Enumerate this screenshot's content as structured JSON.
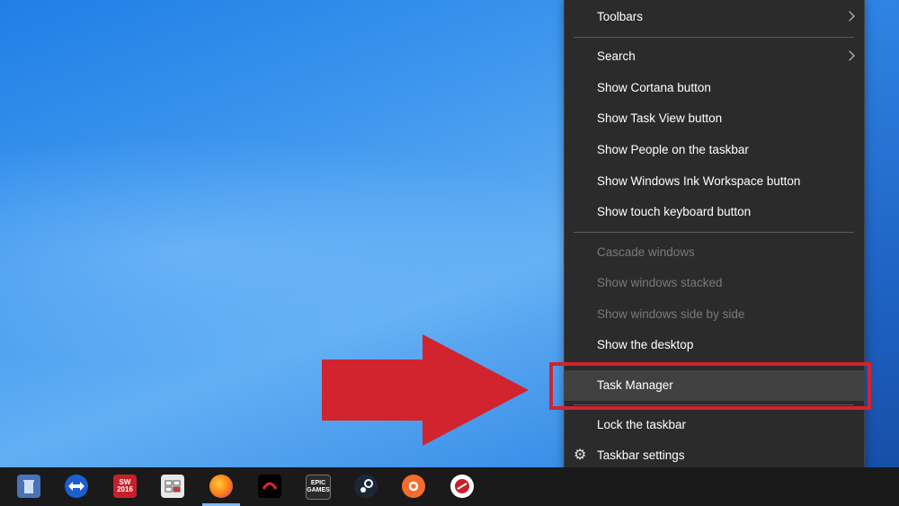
{
  "menu": {
    "items": [
      {
        "label": "Toolbars",
        "has_submenu": true
      },
      {
        "label": "Search",
        "has_submenu": true
      },
      {
        "label": "Show Cortana button"
      },
      {
        "label": "Show Task View button"
      },
      {
        "label": "Show People on the taskbar"
      },
      {
        "label": "Show Windows Ink Workspace button"
      },
      {
        "label": "Show touch keyboard button"
      },
      {
        "label": "Cascade windows",
        "disabled": true
      },
      {
        "label": "Show windows stacked",
        "disabled": true
      },
      {
        "label": "Show windows side by side",
        "disabled": true
      },
      {
        "label": "Show the desktop"
      },
      {
        "label": "Task Manager",
        "highlighted": true
      },
      {
        "label": "Lock the taskbar"
      },
      {
        "label": "Taskbar settings",
        "icon": "gear-icon"
      }
    ]
  },
  "taskbar": {
    "icons": [
      {
        "name": "recycle-bin-icon",
        "text": ""
      },
      {
        "name": "teamviewer-icon",
        "text": ""
      },
      {
        "name": "solidworks-icon",
        "text": "SW\n2016"
      },
      {
        "name": "keyboard-app-icon",
        "text": ""
      },
      {
        "name": "firefox-icon",
        "text": ""
      },
      {
        "name": "garena-icon",
        "text": ""
      },
      {
        "name": "epic-games-icon",
        "text": "EPIC\nGAMES"
      },
      {
        "name": "steam-icon",
        "text": ""
      },
      {
        "name": "origin-icon",
        "text": ""
      },
      {
        "name": "world-of-tanks-icon",
        "text": ""
      }
    ]
  },
  "colors": {
    "menu_bg": "#2b2b2b",
    "highlight_box": "#d1242f",
    "arrow": "#d1242f",
    "taskbar_bg": "#1a1a1a"
  }
}
